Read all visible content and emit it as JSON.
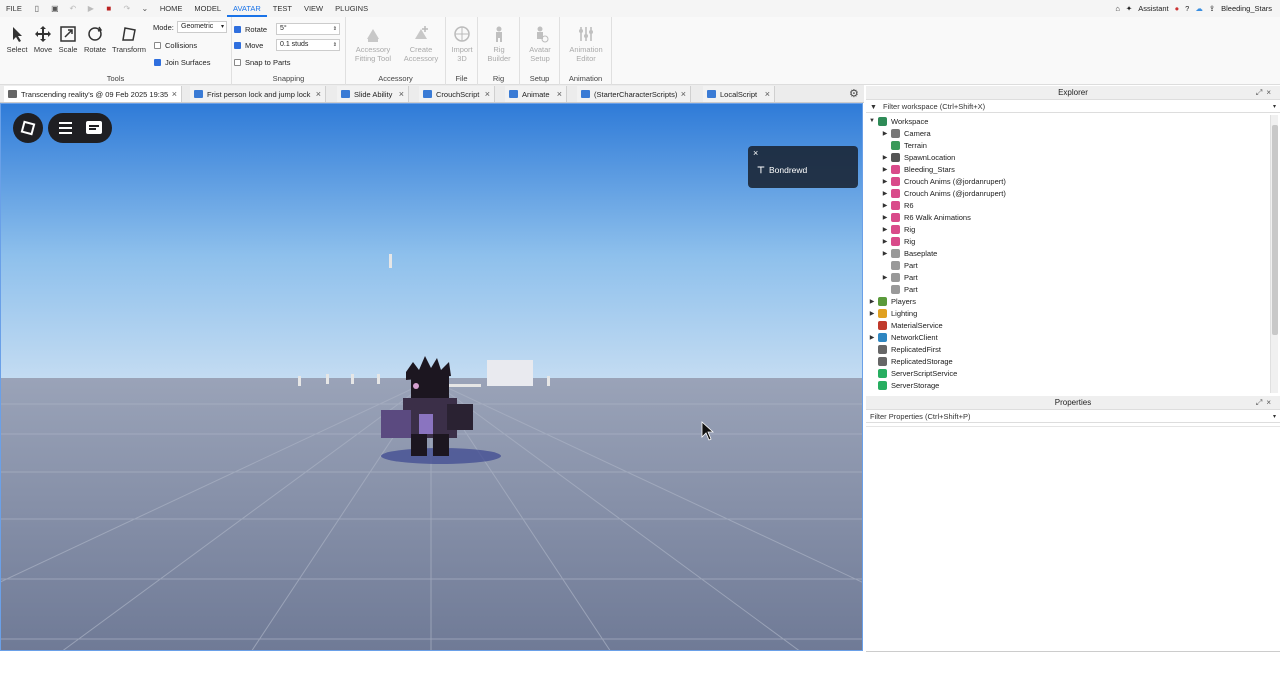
{
  "menubar": {
    "file": "FILE",
    "tabs": [
      "HOME",
      "MODEL",
      "AVATAR",
      "TEST",
      "VIEW",
      "PLUGINS"
    ],
    "active_tab": "AVATAR",
    "assistant": "Assistant",
    "username": "Bleeding_Stars"
  },
  "ribbon": {
    "tools": {
      "title": "Tools",
      "select": "Select",
      "move": "Move",
      "scale": "Scale",
      "rotate": "Rotate",
      "transform": "Transform",
      "mode_label": "Mode:",
      "mode_value": "Geometric",
      "collisions": "Collisions",
      "join_surfaces": "Join Surfaces"
    },
    "snapping": {
      "title": "Snapping",
      "rotate": "Rotate",
      "rotate_value": "5°",
      "move": "Move",
      "move_value": "0.1 studs",
      "snap_to_parts": "Snap to Parts"
    },
    "accessory": {
      "title": "Accessory",
      "fitting_tool": [
        "Accessory",
        "Fitting Tool"
      ],
      "create": [
        "Create",
        "Accessory"
      ]
    },
    "file": {
      "title": "File",
      "import": [
        "Import",
        "3D"
      ]
    },
    "rig": {
      "title": "Rig",
      "builder": [
        "Rig",
        "Builder"
      ]
    },
    "setup": {
      "title": "Setup",
      "avatar_setup": [
        "Avatar",
        "Setup"
      ]
    },
    "animation": {
      "title": "Animation",
      "editor": [
        "Animation",
        "Editor"
      ]
    }
  },
  "tabs": [
    "Transcending reality's @ 09 Feb 2025 19:35",
    "Frist person lock and jump lock",
    "Slide Ability",
    "CrouchScript",
    "Animate",
    "(StarterCharacterScripts)",
    "LocalScript"
  ],
  "viewport": {
    "toast_name": "Bondrewd"
  },
  "explorer": {
    "title": "Explorer",
    "filter": "Filter workspace (Ctrl+Shift+X)",
    "items": [
      {
        "label": "Workspace",
        "depth": 0,
        "expand": "open",
        "icon": "globe-icon",
        "color": "#2e8b57"
      },
      {
        "label": "Camera",
        "depth": 1,
        "expand": "closed",
        "icon": "camera-icon",
        "color": "#777777"
      },
      {
        "label": "Terrain",
        "depth": 1,
        "expand": "none",
        "icon": "terrain-icon",
        "color": "#3a9a5a"
      },
      {
        "label": "SpawnLocation",
        "depth": 1,
        "expand": "closed",
        "icon": "spawn-icon",
        "color": "#555555"
      },
      {
        "label": "Bleeding_Stars",
        "depth": 1,
        "expand": "closed",
        "icon": "model-icon",
        "color": "#d94a8a"
      },
      {
        "label": "Crouch Anims (@jordanrupert)",
        "depth": 1,
        "expand": "closed",
        "icon": "model-icon",
        "color": "#d94a8a"
      },
      {
        "label": "Crouch Anims (@jordanrupert)",
        "depth": 1,
        "expand": "closed",
        "icon": "model-icon",
        "color": "#d94a8a"
      },
      {
        "label": "R6",
        "depth": 1,
        "expand": "closed",
        "icon": "model-icon",
        "color": "#d94a8a"
      },
      {
        "label": "R6 Walk Animations",
        "depth": 1,
        "expand": "closed",
        "icon": "model-icon",
        "color": "#d94a8a"
      },
      {
        "label": "Rig",
        "depth": 1,
        "expand": "closed",
        "icon": "model-icon",
        "color": "#d94a8a"
      },
      {
        "label": "Rig",
        "depth": 1,
        "expand": "closed",
        "icon": "model-icon",
        "color": "#d94a8a"
      },
      {
        "label": "Baseplate",
        "depth": 1,
        "expand": "closed",
        "icon": "part-icon",
        "color": "#999999"
      },
      {
        "label": "Part",
        "depth": 1,
        "expand": "none",
        "icon": "part-icon",
        "color": "#999999"
      },
      {
        "label": "Part",
        "depth": 1,
        "expand": "closed",
        "icon": "part-icon",
        "color": "#999999"
      },
      {
        "label": "Part",
        "depth": 1,
        "expand": "none",
        "icon": "part-icon",
        "color": "#999999"
      },
      {
        "label": "Players",
        "depth": 0,
        "expand": "closed",
        "icon": "players-icon",
        "color": "#5a9a3a"
      },
      {
        "label": "Lighting",
        "depth": 0,
        "expand": "closed",
        "icon": "lightbulb-icon",
        "color": "#e0a020"
      },
      {
        "label": "MaterialService",
        "depth": 0,
        "expand": "none",
        "icon": "material-icon",
        "color": "#c0392b"
      },
      {
        "label": "NetworkClient",
        "depth": 0,
        "expand": "closed",
        "icon": "network-icon",
        "color": "#2e86c1"
      },
      {
        "label": "ReplicatedFirst",
        "depth": 0,
        "expand": "none",
        "icon": "replicated-icon",
        "color": "#666666"
      },
      {
        "label": "ReplicatedStorage",
        "depth": 0,
        "expand": "none",
        "icon": "storage-icon",
        "color": "#666666"
      },
      {
        "label": "ServerScriptService",
        "depth": 0,
        "expand": "none",
        "icon": "server-script-icon",
        "color": "#27ae60"
      },
      {
        "label": "ServerStorage",
        "depth": 0,
        "expand": "none",
        "icon": "server-storage-icon",
        "color": "#27ae60"
      }
    ]
  },
  "properties": {
    "title": "Properties",
    "filter": "Filter Properties (Ctrl+Shift+P)"
  }
}
